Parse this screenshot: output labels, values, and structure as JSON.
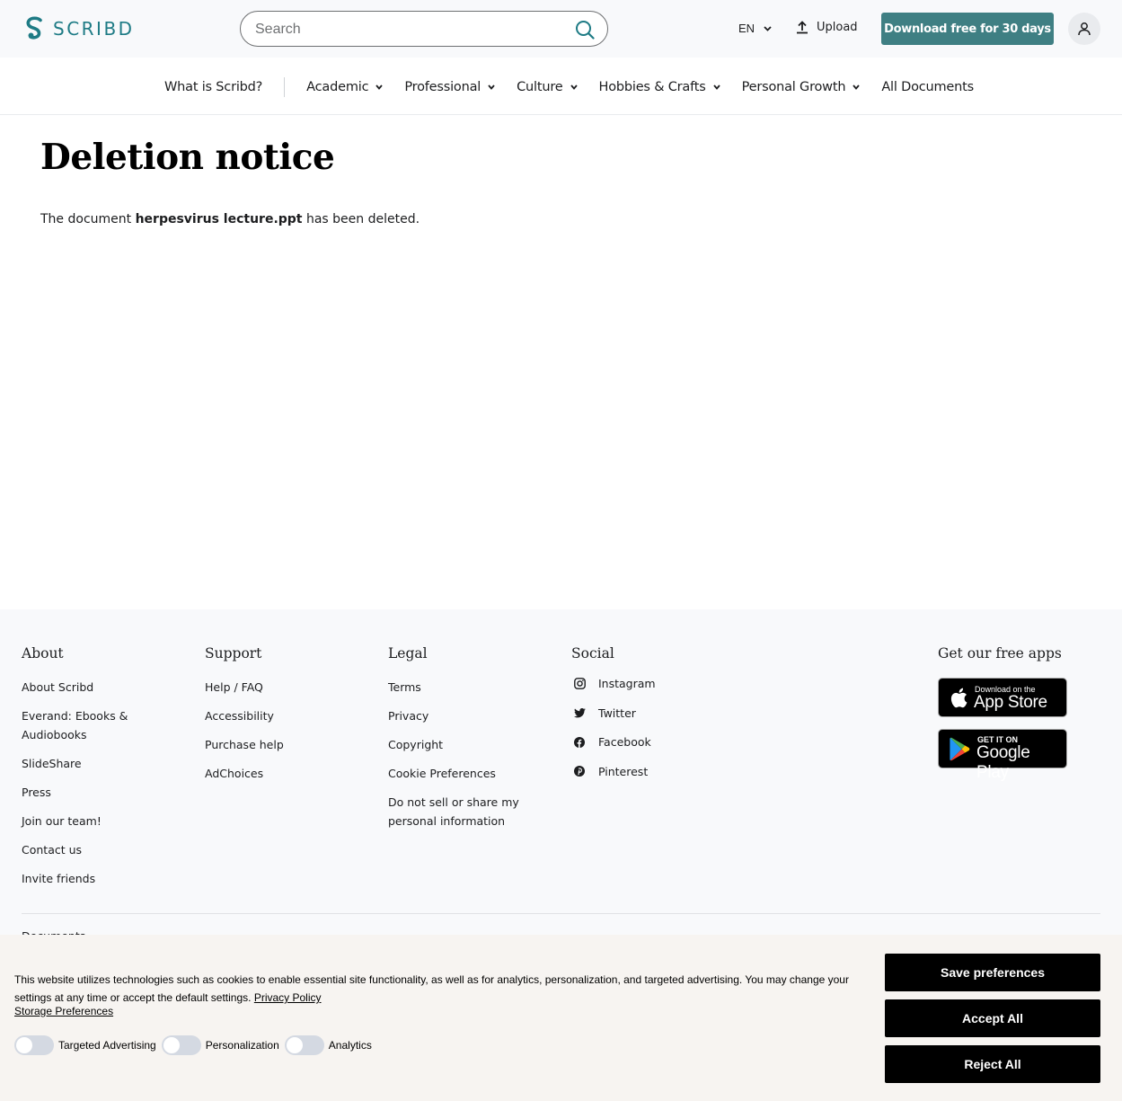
{
  "header": {
    "logo_text": "SCRIBD",
    "search_placeholder": "Search",
    "language": "EN",
    "upload_label": "Upload",
    "cta_label": "Download free for 30 days"
  },
  "nav": {
    "items": [
      {
        "label": "What is Scribd?"
      },
      {
        "label": "Academic"
      },
      {
        "label": "Professional"
      },
      {
        "label": "Culture"
      },
      {
        "label": "Hobbies & Crafts"
      },
      {
        "label": "Personal Growth"
      },
      {
        "label": "All Documents"
      }
    ]
  },
  "main": {
    "title": "Deletion notice",
    "notice_prefix": "The document",
    "document_name": "herpesvirus lecture.ppt",
    "notice_suffix": "has been deleted."
  },
  "footer": {
    "about": {
      "heading": "About",
      "links": [
        "About Scribd",
        "Everand: Ebooks &",
        "Audiobooks",
        "SlideShare",
        "Press",
        "Join our team!",
        "Contact us",
        "Invite friends"
      ]
    },
    "support": {
      "heading": "Support",
      "links": [
        "Help / FAQ",
        "Accessibility",
        "Purchase help",
        "AdChoices"
      ]
    },
    "legal": {
      "heading": "Legal",
      "links": [
        "Terms",
        "Privacy",
        "Copyright",
        "Cookie Preferences",
        "Do not sell or share my",
        "personal information"
      ]
    },
    "social": {
      "heading": "Social",
      "links": [
        {
          "label": "Instagram",
          "icon": "instagram-icon"
        },
        {
          "label": "Twitter",
          "icon": "twitter-icon"
        },
        {
          "label": "Facebook",
          "icon": "facebook-icon"
        },
        {
          "label": "Pinterest",
          "icon": "pinterest-icon"
        }
      ]
    },
    "apps": {
      "heading": "Get our free apps",
      "app_store_small": "Download on the",
      "app_store_big": "App Store",
      "google_small": "GET IT ON",
      "google_big": "Google Play"
    },
    "cut_text": "Documents"
  },
  "cookie_banner": {
    "text": "This website utilizes technologies such as cookies to enable essential site functionality, as well as for analytics, personalization, and targeted advertising. You may change your settings at any time or accept the default settings.",
    "privacy_link": "Privacy Policy",
    "storage_link": "Storage Preferences",
    "toggles": [
      "Targeted Advertising",
      "Personalization",
      "Analytics"
    ],
    "save_label": "Save preferences",
    "accept_label": "Accept All",
    "reject_label": "Reject All"
  },
  "colors": {
    "brand": "#1e7b85",
    "cta": "#3f7f83",
    "footer_bg": "#f8f9fb",
    "cookie_bg": "#f7f4f1"
  }
}
